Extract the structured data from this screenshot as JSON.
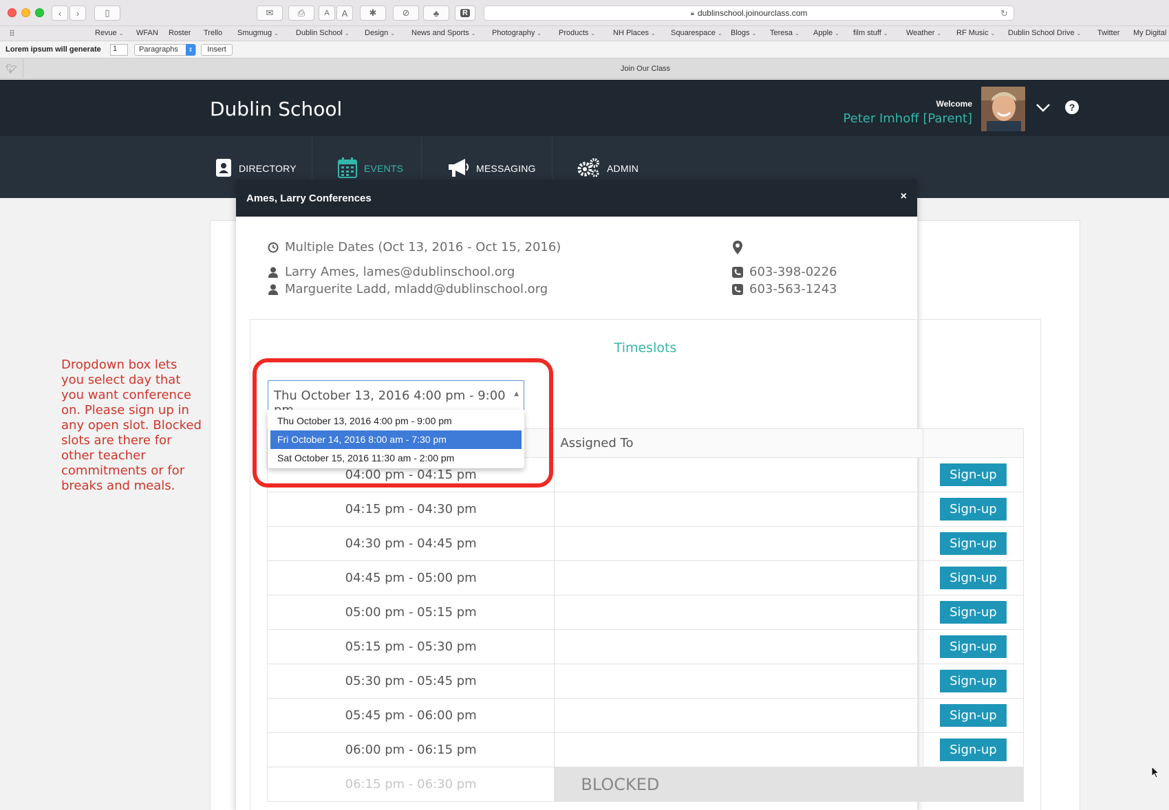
{
  "browser": {
    "url": "dublinschool.joinourclass.com",
    "tab_title": "Join Our Class",
    "bookmarks": [
      {
        "label": "Revue",
        "menu": true
      },
      {
        "label": "WFAN",
        "menu": false
      },
      {
        "label": "Roster",
        "menu": false
      },
      {
        "label": "Trello",
        "menu": false
      },
      {
        "label": "Smugmug",
        "menu": true
      },
      {
        "label": "Dublin School",
        "menu": true
      },
      {
        "label": "Design",
        "menu": true
      },
      {
        "label": "News and Sports",
        "menu": true
      },
      {
        "label": "Photography",
        "menu": true
      },
      {
        "label": "Products",
        "menu": true
      },
      {
        "label": "NH Places",
        "menu": true
      },
      {
        "label": "Squarespace",
        "menu": true
      },
      {
        "label": "Blogs",
        "menu": true
      },
      {
        "label": "Teresa",
        "menu": true
      },
      {
        "label": "Apple",
        "menu": true
      },
      {
        "label": "film stuff",
        "menu": true
      },
      {
        "label": "Weather",
        "menu": true
      },
      {
        "label": "RF Music",
        "menu": true
      },
      {
        "label": "Dublin School Drive",
        "menu": true
      },
      {
        "label": "Twitter",
        "menu": false
      },
      {
        "label": "My Digital",
        "menu": false
      }
    ],
    "lorem": {
      "label": "Lorem ipsum will generate",
      "count": "1",
      "type": "Paragraphs",
      "insert": "Insert"
    }
  },
  "header": {
    "school": "Dublin School",
    "welcome": "Welcome",
    "user": "Peter Imhoff [Parent]",
    "help": "?"
  },
  "nav": {
    "directory": "DIRECTORY",
    "events": "EVENTS",
    "messaging": "MESSAGING",
    "admin": "ADMIN"
  },
  "annotation": "Dropdown box lets you select day that you want conference on.  Please sign up in any open slot. Blocked slots are there for other teacher commitments or for breaks and meals.",
  "modal": {
    "title": "Ames, Larry Conferences",
    "close": "×",
    "dates": "Multiple Dates (Oct 13, 2016 - Oct 15, 2016)",
    "contacts": [
      {
        "name": "Larry Ames, lames@dublinschool.org",
        "phone": "603-398-0226"
      },
      {
        "name": "Marguerite Ladd, mladd@dublinschool.org",
        "phone": "603-563-1243"
      }
    ],
    "timeslots_title": "Timeslots",
    "selected_day": "Thu October 13, 2016 4:00 pm - 9:00 pm",
    "day_options": [
      "Thu October 13, 2016 4:00 pm - 9:00 pm",
      "Fri October 14, 2016 8:00 am - 7:30 pm",
      "Sat October 15, 2016 11:30 am - 2:00 pm"
    ],
    "highlighted_option": 1,
    "columns": {
      "assigned": "Assigned To"
    },
    "signup_label": "Sign-up",
    "blocked_label": "BLOCKED",
    "slots": [
      {
        "time": "04:00 pm - 04:15 pm",
        "status": "open"
      },
      {
        "time": "04:15 pm - 04:30 pm",
        "status": "open"
      },
      {
        "time": "04:30 pm - 04:45 pm",
        "status": "open"
      },
      {
        "time": "04:45 pm - 05:00 pm",
        "status": "open"
      },
      {
        "time": "05:00 pm - 05:15 pm",
        "status": "open"
      },
      {
        "time": "05:15 pm - 05:30 pm",
        "status": "open"
      },
      {
        "time": "05:30 pm - 05:45 pm",
        "status": "open"
      },
      {
        "time": "05:45 pm - 06:00 pm",
        "status": "open"
      },
      {
        "time": "06:00 pm - 06:15 pm",
        "status": "open"
      },
      {
        "time": "06:15 pm - 06:30 pm",
        "status": "blocked"
      }
    ]
  }
}
